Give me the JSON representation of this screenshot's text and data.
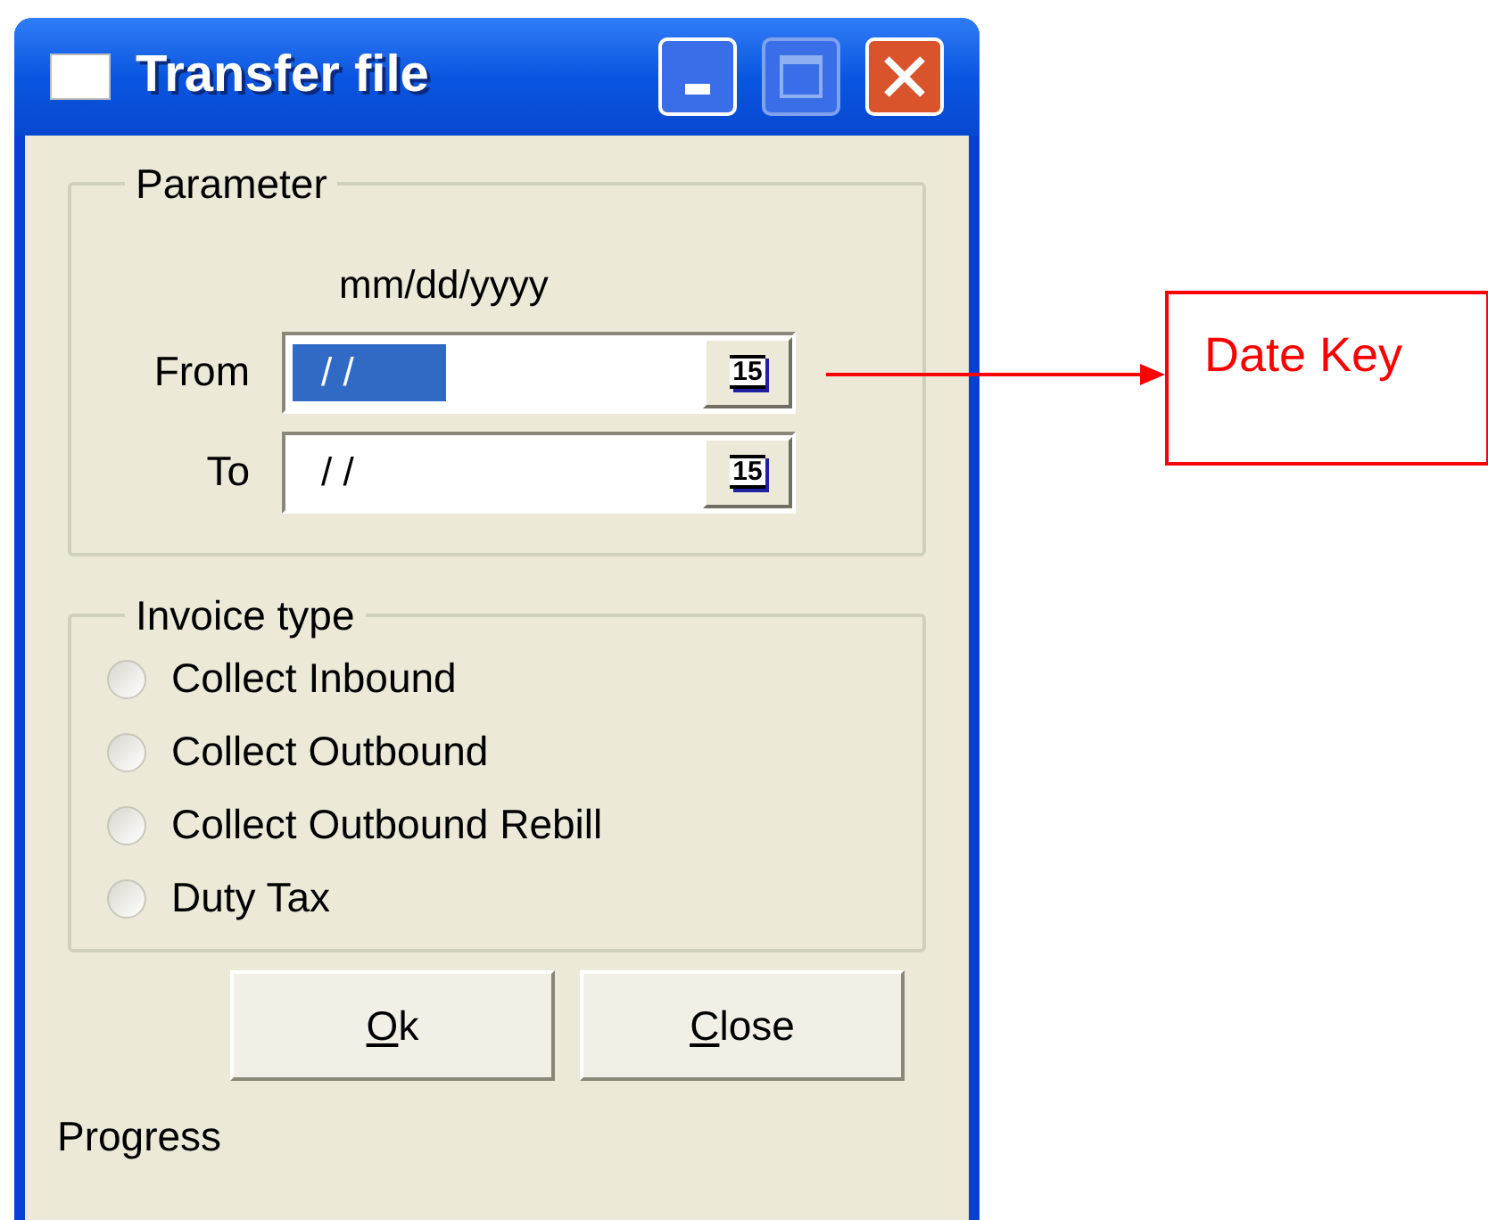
{
  "window": {
    "title": "Transfer file"
  },
  "parameter": {
    "legend": "Parameter",
    "format_hint": "mm/dd/yyyy",
    "fields": [
      {
        "label": "From",
        "value": "/ /",
        "selected": true,
        "button": "15"
      },
      {
        "label": "To",
        "value": "/ /",
        "selected": false,
        "button": "15"
      }
    ]
  },
  "invoice_type": {
    "legend": "Invoice type",
    "options": [
      {
        "label": "Collect Inbound",
        "selected": false
      },
      {
        "label": "Collect Outbound",
        "selected": false
      },
      {
        "label": "Collect Outbound Rebill",
        "selected": false
      },
      {
        "label": "Duty Tax",
        "selected": false
      }
    ]
  },
  "buttons": [
    {
      "label": "Ok",
      "mnemonic_underlined": true
    },
    {
      "label": "Close",
      "mnemonic_underlined": true
    }
  ],
  "status": "Progress",
  "annotation": {
    "text": "Date Key"
  }
}
